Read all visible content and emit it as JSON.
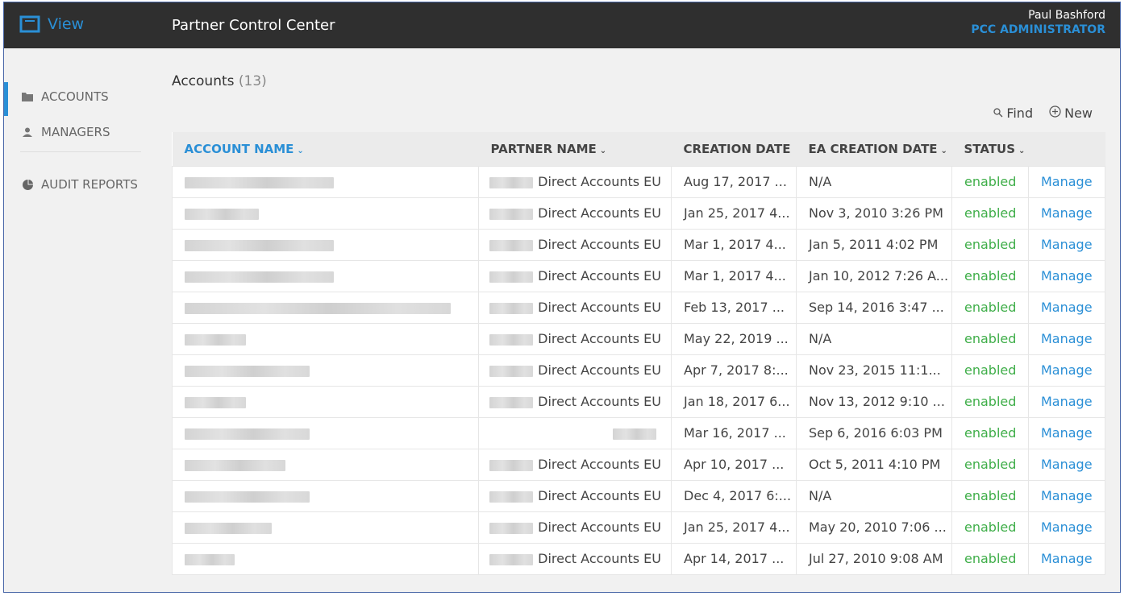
{
  "app": {
    "logo_text": "View",
    "title": "Partner Control Center",
    "user_name": "Paul Bashford",
    "user_role": "PCC ADMINISTRATOR"
  },
  "sidebar": {
    "items": [
      {
        "label": "ACCOUNTS",
        "icon": "folder-icon"
      },
      {
        "label": "MANAGERS",
        "icon": "user-icon"
      },
      {
        "label": "AUDIT REPORTS",
        "icon": "pie-chart-icon"
      }
    ]
  },
  "main": {
    "title": "Accounts",
    "count": "(13)",
    "find_label": "Find",
    "new_label": "New"
  },
  "table": {
    "columns": [
      "ACCOUNT NAME",
      "PARTNER NAME",
      "CREATION DATE",
      "EA CREATION DATE",
      "STATUS",
      ""
    ],
    "rows": [
      {
        "partner": "Direct Accounts EU",
        "created": "Aug 17, 2017 ...",
        "ea_created": "N/A",
        "status": "enabled",
        "action": "Manage"
      },
      {
        "partner": "Direct Accounts EU",
        "created": "Jan 25, 2017 4...",
        "ea_created": "Nov 3, 2010 3:26 PM",
        "status": "enabled",
        "action": "Manage"
      },
      {
        "partner": "Direct Accounts EU",
        "created": "Mar 1, 2017 4...",
        "ea_created": "Jan 5, 2011 4:02 PM",
        "status": "enabled",
        "action": "Manage"
      },
      {
        "partner": "Direct Accounts EU",
        "created": "Mar 1, 2017 4...",
        "ea_created": "Jan 10, 2012 7:26 A...",
        "status": "enabled",
        "action": "Manage"
      },
      {
        "partner": "Direct Accounts EU",
        "created": "Feb 13, 2017 ...",
        "ea_created": "Sep 14, 2016 3:47 ...",
        "status": "enabled",
        "action": "Manage"
      },
      {
        "partner": "Direct Accounts EU",
        "created": "May 22, 2019 ...",
        "ea_created": "N/A",
        "status": "enabled",
        "action": "Manage"
      },
      {
        "partner": "Direct Accounts EU",
        "created": "Apr 7, 2017 8:...",
        "ea_created": "Nov 23, 2015 11:1...",
        "status": "enabled",
        "action": "Manage"
      },
      {
        "partner": "Direct Accounts EU",
        "created": "Jan 18, 2017 6...",
        "ea_created": "Nov 13, 2012 9:10 ...",
        "status": "enabled",
        "action": "Manage"
      },
      {
        "partner": "",
        "created": "Mar 16, 2017 ...",
        "ea_created": "Sep 6, 2016 6:03 PM",
        "status": "enabled",
        "action": "Manage"
      },
      {
        "partner": "Direct Accounts EU",
        "created": "Apr 10, 2017 ...",
        "ea_created": "Oct 5, 2011 4:10 PM",
        "status": "enabled",
        "action": "Manage"
      },
      {
        "partner": "Direct Accounts EU",
        "created": "Dec 4, 2017 6:...",
        "ea_created": "N/A",
        "status": "enabled",
        "action": "Manage"
      },
      {
        "partner": "Direct Accounts EU",
        "created": "Jan 25, 2017 4...",
        "ea_created": "May 20, 2010 7:06 ...",
        "status": "enabled",
        "action": "Manage"
      },
      {
        "partner": "Direct Accounts EU",
        "created": "Apr 14, 2017 ...",
        "ea_created": "Jul 27, 2010 9:08 AM",
        "status": "enabled",
        "action": "Manage"
      }
    ]
  },
  "colors": {
    "accent": "#2a8fd6",
    "enabled": "#3fae49",
    "topbar": "#2f2f2f"
  }
}
